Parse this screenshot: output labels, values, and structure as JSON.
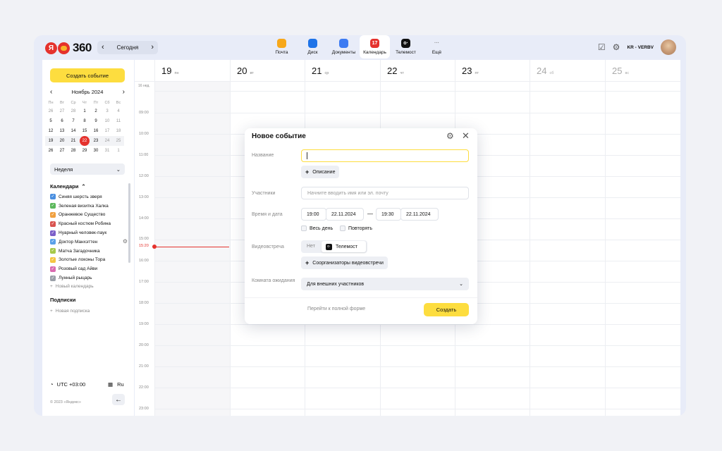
{
  "header": {
    "logo_ya": "Я",
    "logo_num": "360",
    "today_label": "Сегодня",
    "services": [
      {
        "label": "Почта",
        "icon": "mail-icon",
        "color": "#f7a81b",
        "glyph": "",
        "active": false
      },
      {
        "label": "Диск",
        "icon": "disk-icon",
        "color": "#1e73e8",
        "glyph": "",
        "active": false
      },
      {
        "label": "Документы",
        "icon": "documents-icon",
        "color": "#3d7bf2",
        "glyph": "",
        "active": false
      },
      {
        "label": "Календарь",
        "icon": "calendar-icon",
        "color": "#e5322d",
        "glyph": "17",
        "active": true
      },
      {
        "label": "Телемост",
        "icon": "telemost-icon",
        "color": "#111111",
        "glyph": "o·",
        "active": false
      },
      {
        "label": "Ещё",
        "icon": "more-icon",
        "color": "#999999",
        "glyph": "···",
        "active": false
      }
    ],
    "user": "KR - VERBV"
  },
  "sidebar": {
    "create_label": "Создать событие",
    "month_label": "Ноябрь 2024",
    "weekdays": [
      "Пн",
      "Вт",
      "Ср",
      "Чт",
      "Пт",
      "Сб",
      "Вс"
    ],
    "weeks": [
      [
        "26",
        "27",
        "28",
        "1",
        "2",
        "3",
        "4"
      ],
      [
        "5",
        "6",
        "7",
        "8",
        "9",
        "10",
        "11"
      ],
      [
        "12",
        "13",
        "14",
        "15",
        "16",
        "17",
        "18"
      ],
      [
        "19",
        "20",
        "21",
        "22",
        "23",
        "24",
        "25"
      ],
      [
        "26",
        "27",
        "28",
        "29",
        "30",
        "31",
        "1"
      ]
    ],
    "selected_day": "22",
    "view_label": "Неделя",
    "calendars_heading": "Календари",
    "calendars": [
      {
        "name": "Синяя шерсть зверя",
        "color": "#4a8fe0"
      },
      {
        "name": "Зеленая визитка Халка",
        "color": "#5cb85c"
      },
      {
        "name": "Оранжевое Существо",
        "color": "#f0a040"
      },
      {
        "name": "Красный костюм Робина",
        "color": "#d9534f"
      },
      {
        "name": "Нуарный человек-паук",
        "color": "#7b5fc9"
      },
      {
        "name": "Доктор Манхэттен",
        "color": "#5aa0e8"
      },
      {
        "name": "Матча Загадочника",
        "color": "#a6c94a"
      },
      {
        "name": "Золотые локоны Тора",
        "color": "#f4c542"
      },
      {
        "name": "Розовый сад Айви",
        "color": "#d96bb0"
      },
      {
        "name": "Лунный рыцарь",
        "color": "#9aa0a8"
      }
    ],
    "new_calendar": "Новый календарь",
    "subscriptions_heading": "Подписки",
    "new_subscription": "Новая подписка",
    "timezone": "UTC +03:00",
    "language": "Ru",
    "copyright": "© 2023 «Яндекс»"
  },
  "calendar": {
    "days": [
      {
        "num": "19",
        "dow": "пн",
        "weekend": false
      },
      {
        "num": "20",
        "dow": "вт",
        "weekend": false
      },
      {
        "num": "21",
        "dow": "ср",
        "weekend": false
      },
      {
        "num": "22",
        "dow": "чт",
        "weekend": false
      },
      {
        "num": "23",
        "dow": "пт",
        "weekend": false
      },
      {
        "num": "24",
        "dow": "сб",
        "weekend": true
      },
      {
        "num": "25",
        "dow": "вс",
        "weekend": true
      }
    ],
    "week_label": "16 нед.",
    "hours": [
      "09:00",
      "10:00",
      "11:00",
      "12:00",
      "13:00",
      "14:00",
      "15:00",
      "16:00",
      "17:00",
      "18:00",
      "19:00",
      "20:00",
      "21:00",
      "22:00",
      "23:00"
    ],
    "now_time": "15:20"
  },
  "modal": {
    "title": "Новое событие",
    "name_label": "Название",
    "description_button": "Описание",
    "participants_label": "Участники",
    "participants_placeholder": "Начните вводить имя или эл. почту",
    "datetime_label": "Время и дата",
    "start_time": "19:00",
    "start_date": "22.11.2024",
    "end_time": "19:30",
    "end_date": "22.11.2024",
    "allday_label": "Весь день",
    "repeat_label": "Повторять",
    "video_label": "Видеовстреча",
    "video_off": "Нет",
    "video_on": "Телемост",
    "coorganizers_button": "Соорганизаторы видеовстречи",
    "waiting_room_label": "Комната ожидания",
    "waiting_room_value": "Для внешних участников",
    "full_form_link": "Перейти к полной форме",
    "create_button": "Создать"
  }
}
